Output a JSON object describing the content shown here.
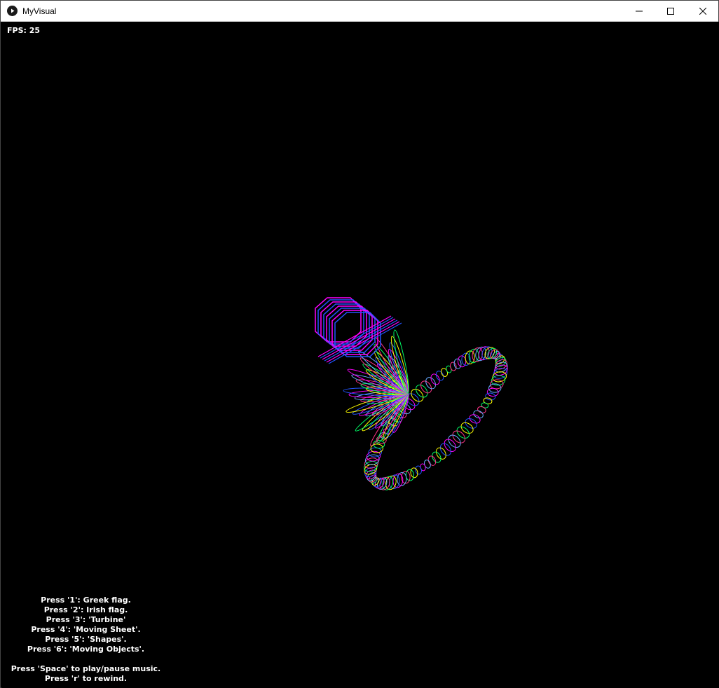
{
  "window": {
    "title": "MyVisual",
    "controls": {
      "minimize": "minimize",
      "maximize": "maximize",
      "close": "close"
    }
  },
  "canvas": {
    "fps_label": "FPS:",
    "fps_value": "25",
    "background": "#000000",
    "visual_colors": [
      "#ff00ff",
      "#2255ff",
      "#ffff00",
      "#00ff66",
      "#ff3388",
      "#66aaff"
    ]
  },
  "help": {
    "modes": [
      "Press '1': Greek flag.",
      "Press '2': Irish flag.",
      "Press '3': 'Turbine'",
      "Press '4': 'Moving Sheet'.",
      "Press '5': 'Shapes'.",
      "Press '6': 'Moving Objects'."
    ],
    "controls": [
      "Press 'Space' to play/pause music.",
      "Press 'r' to rewind."
    ]
  }
}
